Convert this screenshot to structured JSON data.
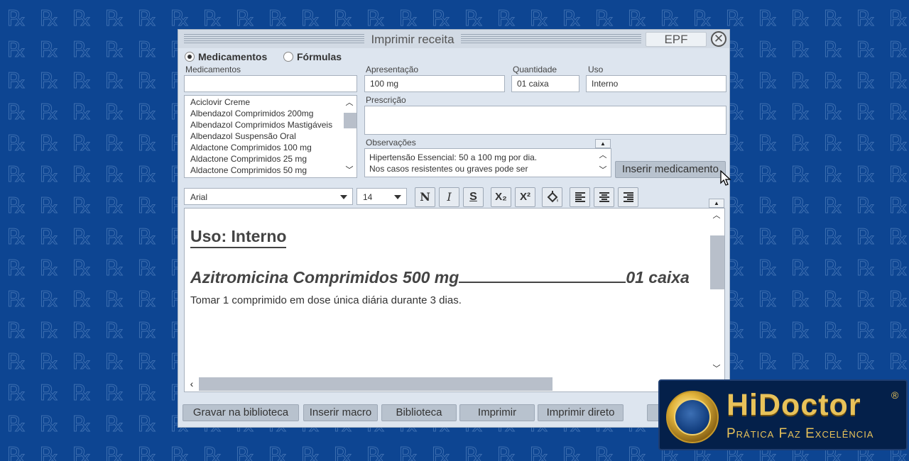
{
  "window": {
    "title": "Imprimir receita",
    "epf_label": "EPF",
    "close_label": "✕"
  },
  "mode": {
    "option1": "Medicamentos",
    "option2": "Fórmulas",
    "selected": "Medicamentos"
  },
  "labels": {
    "medicamentos": "Medicamentos",
    "apresentacao": "Apresentação",
    "quantidade": "Quantidade",
    "uso": "Uso",
    "prescricao": "Prescrição",
    "observacoes": "Observações"
  },
  "fields": {
    "medicamentos": "",
    "apresentacao": "100 mg",
    "quantidade": "01 caixa",
    "uso": "Interno",
    "prescricao": ""
  },
  "med_list": [
    "Aciclovir Creme",
    "Albendazol Comprimidos 200mg",
    "Albendazol Comprimidos Mastigáveis",
    "Albendazol Suspensão Oral",
    "Aldactone Comprimidos 100 mg",
    "Aldactone Comprimidos 25 mg",
    "Aldactone Comprimidos 50 mg"
  ],
  "observacoes": {
    "line1": "Hipertensão Essencial: 50 a 100 mg por dia.",
    "line2": "Nos casos resistentes ou graves pode ser"
  },
  "insert_button": "Inserir medicamento",
  "toolbar": {
    "font": "Arial",
    "size": "14",
    "bold": "N",
    "italic": "I",
    "strike": "S",
    "subscript": "X₂",
    "superscript": "X²"
  },
  "editor": {
    "heading": "Uso: Interno",
    "med_name": "Azitromicina Comprimidos 500 mg",
    "med_qty": "01 caixa",
    "instruction": "Tomar 1 comprimido em dose única diária durante 3 dias."
  },
  "footer": {
    "btn1": "Gravar na biblioteca",
    "btn2": "Inserir macro",
    "btn3": "Biblioteca",
    "btn4": "Imprimir",
    "btn5": "Imprimir direto"
  },
  "brand": {
    "name": "HiDoctor",
    "reg": "®",
    "tagline": "Prática Faz Excelência"
  },
  "colors": {
    "background": "#0d4592",
    "window": "#dde5ef",
    "button": "#b8c2ce",
    "brand_gold": "#e8c25a"
  }
}
